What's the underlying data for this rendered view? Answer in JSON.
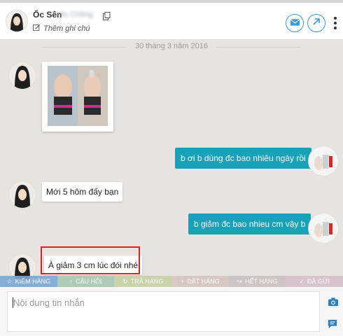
{
  "header": {
    "name": "Ốc Sên",
    "name_extra": "Mu Chồng",
    "note_label": "Thêm ghi chú",
    "icons": [
      "copy-icon",
      "edit-icon",
      "mail-icon",
      "arrow-up-right-icon",
      "more-vertical-icon"
    ]
  },
  "conversation": {
    "date_separator": "30 tháng 3 năm 2016",
    "messages": [
      {
        "sender": "customer",
        "type": "image"
      },
      {
        "sender": "shop",
        "text": "b ơi b dùng đc bao nhiêu ngày rồi"
      },
      {
        "sender": "customer",
        "text": "Mới 5 hôm đấy bạn"
      },
      {
        "sender": "shop",
        "text": "b giảm đc bao nhieu cm vậy b"
      },
      {
        "sender": "customer",
        "text": "À giảm 3 cm lúc đói nhé"
      }
    ]
  },
  "quick_bar": [
    {
      "label": "Kiểm hàng",
      "color": "#7aa9d6"
    },
    {
      "label": "Câu hỏi",
      "color": "#a9c9b6"
    },
    {
      "label": "Trả hàng",
      "color": "#c6d1a5"
    },
    {
      "label": "Đặt hàng",
      "color": "#d6c5c1"
    },
    {
      "label": "Hết hàng",
      "color": "#c9c3c3"
    },
    {
      "label": "Đã gửi",
      "color": "#d7c0cc"
    }
  ],
  "composer": {
    "placeholder": "Nội dung tin nhắn"
  },
  "colors": {
    "accent": "#3b9ad8",
    "outgoing_bubble": "#17a2b8",
    "highlight": "#e02020"
  }
}
